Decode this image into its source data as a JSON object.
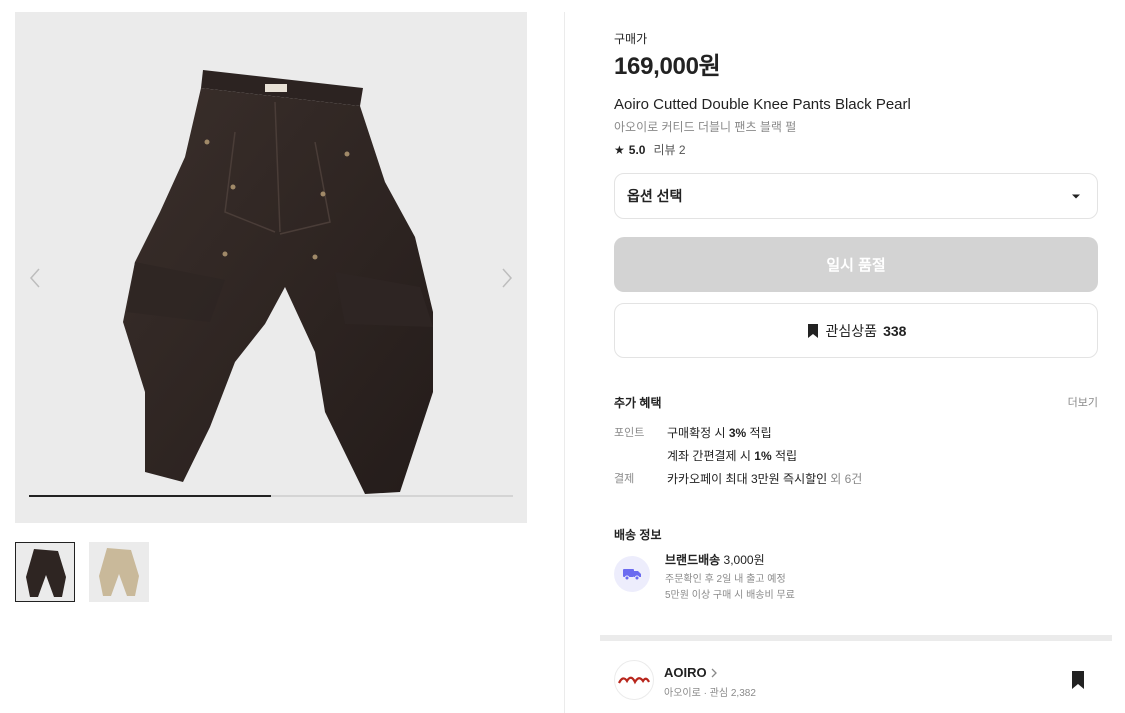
{
  "gallery": {
    "slide_progress": 0.5,
    "thumbnails": [
      {
        "name": "black-pants",
        "color": "#2e2522"
      },
      {
        "name": "beige-pants",
        "color": "#c9b99a"
      }
    ]
  },
  "product": {
    "price_label": "구매가",
    "price": "169,000원",
    "name_en": "Aoiro Cutted Double Knee Pants Black Pearl",
    "name_ko": "아오이로 커티드 더블니 팬츠 블랙 펄",
    "rating_score": "5.0",
    "review_label": "리뷰 2"
  },
  "option": {
    "label": "옵션 선택"
  },
  "buttons": {
    "soldout": "일시 품절",
    "wish_label": "관심상품",
    "wish_count": "338"
  },
  "benefits": {
    "title": "추가 혜택",
    "more": "더보기",
    "point_key": "포인트",
    "point_line1_pre": "구매확정 시 ",
    "point_line1_bold": "3%",
    "point_line1_post": " 적립",
    "point_line2_pre": "계좌 간편결제 시 ",
    "point_line2_bold": "1%",
    "point_line2_post": " 적립",
    "pay_key": "결제",
    "pay_text": "카카오페이 최대 3만원 즉시할인",
    "pay_extra": "외 6건"
  },
  "shipping": {
    "title": "배송 정보",
    "method": "브랜드배송",
    "fee": "3,000원",
    "eta": "주문확인 후 2일 내 출고 예정",
    "free_note": "5만원 이상 구매 시 배송비 무료"
  },
  "brand": {
    "name": "AOIRO",
    "meta": "아오이로 · 관심 2,382"
  },
  "colors": {
    "soldout_bg": "#d3d3d3",
    "ship_icon": "#6b6bf0"
  }
}
